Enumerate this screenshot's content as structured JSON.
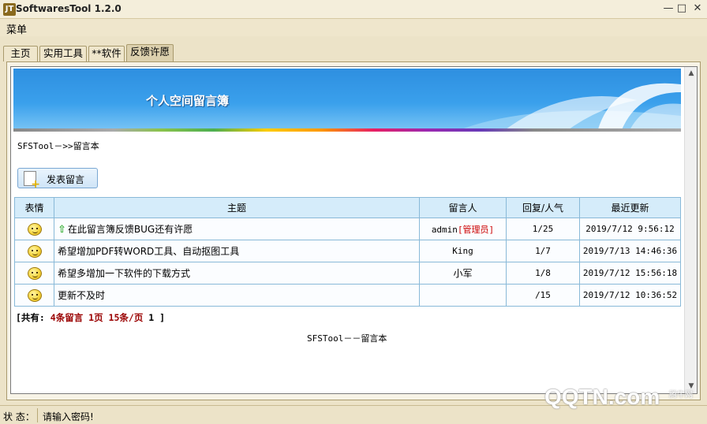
{
  "window": {
    "title": "SoftwaresTool 1.2.0",
    "icon_label": "JT"
  },
  "menu": {
    "label": "菜单"
  },
  "tabs": [
    {
      "label": "主页"
    },
    {
      "label": "实用工具"
    },
    {
      "label": "**软件"
    },
    {
      "label": "反馈许愿"
    }
  ],
  "active_tab": "反馈许愿",
  "banner": {
    "title": "个人空间留言簿"
  },
  "breadcrumb": "SFSTool－>>留言本",
  "post_button": {
    "label": "发表留言"
  },
  "table": {
    "headers": [
      "表情",
      "主题",
      "留言人",
      "回复/人气",
      "最近更新"
    ],
    "rows": [
      {
        "subject": "在此留言簿反馈BUG还有许愿",
        "author": "admin",
        "author_tag": "[管理员]",
        "reply_views": "1/25",
        "updated": "2019/7/12 9:56:12",
        "pinned": true
      },
      {
        "subject": "希望增加PDF转WORD工具、自动抠图工具",
        "author": "King",
        "author_tag": "",
        "reply_views": "1/7",
        "updated": "2019/7/13 14:46:36",
        "pinned": false
      },
      {
        "subject": "希望多增加一下软件的下载方式",
        "author": "小军",
        "author_tag": "",
        "reply_views": "1/8",
        "updated": "2019/7/12 15:56:18",
        "pinned": false
      },
      {
        "subject": "更新不及时",
        "author": "",
        "author_tag": "",
        "reply_views": "/15",
        "updated": "2019/7/12 10:36:52",
        "pinned": false
      }
    ]
  },
  "summary": {
    "open": "[共有:",
    "count": "4条留言",
    "pages": "1页",
    "per_page": "15条/页",
    "current": "1",
    "close": "]"
  },
  "footer": "SFSTool－－留言本",
  "status": {
    "label": "状 态：",
    "message": "请输入密码!"
  },
  "watermark": {
    "brand": "QQTN.com",
    "small": "腾牛网"
  }
}
